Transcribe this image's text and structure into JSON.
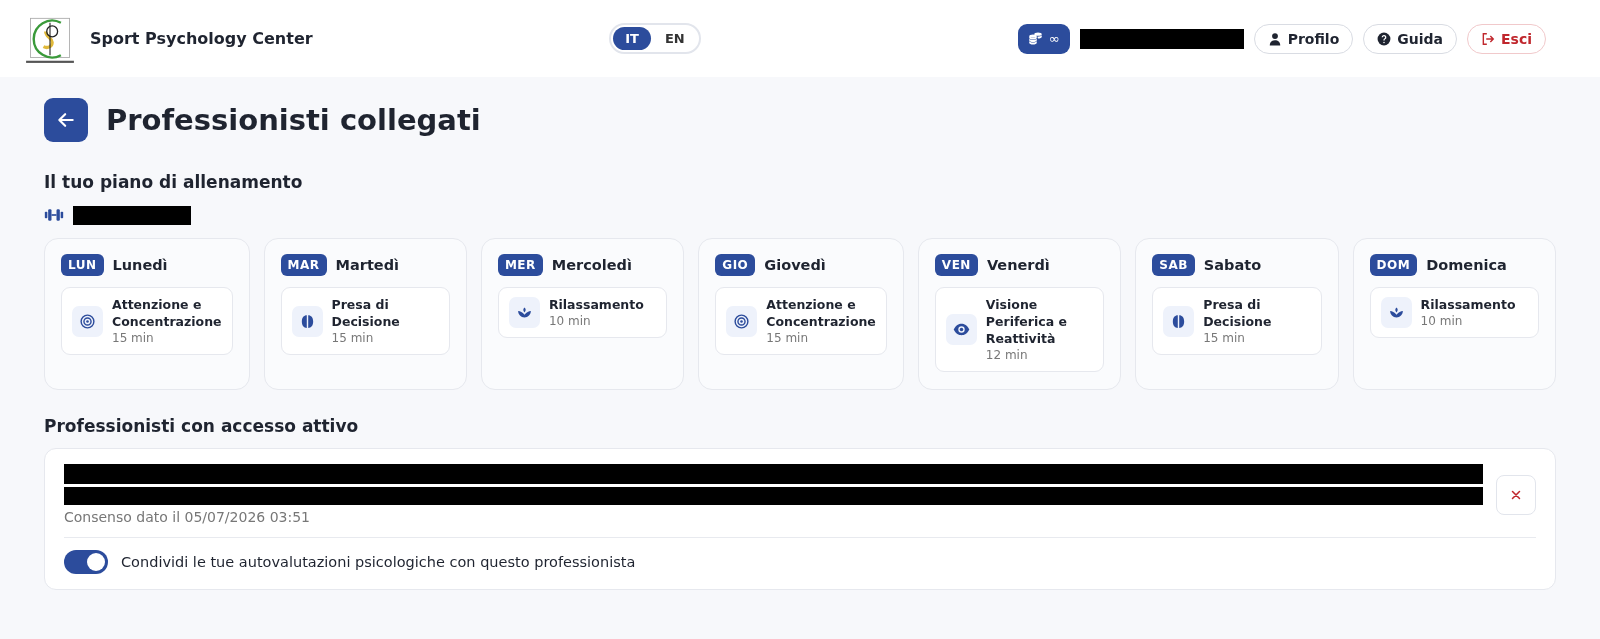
{
  "header": {
    "brand": "Sport Psychology Center",
    "languages": [
      {
        "label": "IT",
        "selected": true
      },
      {
        "label": "EN",
        "selected": false
      }
    ],
    "credits": "∞",
    "buttons": [
      {
        "label": "Profilo",
        "kind": "profile"
      },
      {
        "label": "Guida",
        "kind": "help"
      },
      {
        "label": "Esci",
        "kind": "logout"
      }
    ]
  },
  "page": {
    "title": "Professionisti collegati"
  },
  "plan": {
    "heading": "Il tuo piano di allenamento",
    "days": [
      {
        "abbr": "LUN",
        "name": "Lunedì",
        "exercises": [
          {
            "kind": "target",
            "title": "Attenzione e Concentrazione",
            "duration": "15 min"
          }
        ]
      },
      {
        "abbr": "MAR",
        "name": "Martedì",
        "exercises": [
          {
            "kind": "brain",
            "title": "Presa di Decisione",
            "duration": "15 min"
          }
        ]
      },
      {
        "abbr": "MER",
        "name": "Mercoledì",
        "exercises": [
          {
            "kind": "lotus",
            "title": "Rilassamento",
            "duration": "10 min"
          }
        ]
      },
      {
        "abbr": "GIO",
        "name": "Giovedì",
        "exercises": [
          {
            "kind": "target",
            "title": "Attenzione e Concentrazione",
            "duration": "15 min"
          }
        ]
      },
      {
        "abbr": "VEN",
        "name": "Venerdì",
        "exercises": [
          {
            "kind": "eye",
            "title": "Visione Periferica e Reattività",
            "duration": "12 min"
          }
        ]
      },
      {
        "abbr": "SAB",
        "name": "Sabato",
        "exercises": [
          {
            "kind": "brain",
            "title": "Presa di Decisione",
            "duration": "15 min"
          }
        ]
      },
      {
        "abbr": "DOM",
        "name": "Domenica",
        "exercises": [
          {
            "kind": "lotus",
            "title": "Rilassamento",
            "duration": "10 min"
          }
        ]
      }
    ]
  },
  "access": {
    "heading": "Professionisti con accesso attivo",
    "professionals": [
      {
        "consent": "Consenso dato il 05/07/2026 03:51",
        "share_label": "Condividi le tue autovalutazioni psicologiche con questo professionista",
        "share_on": true
      }
    ]
  }
}
